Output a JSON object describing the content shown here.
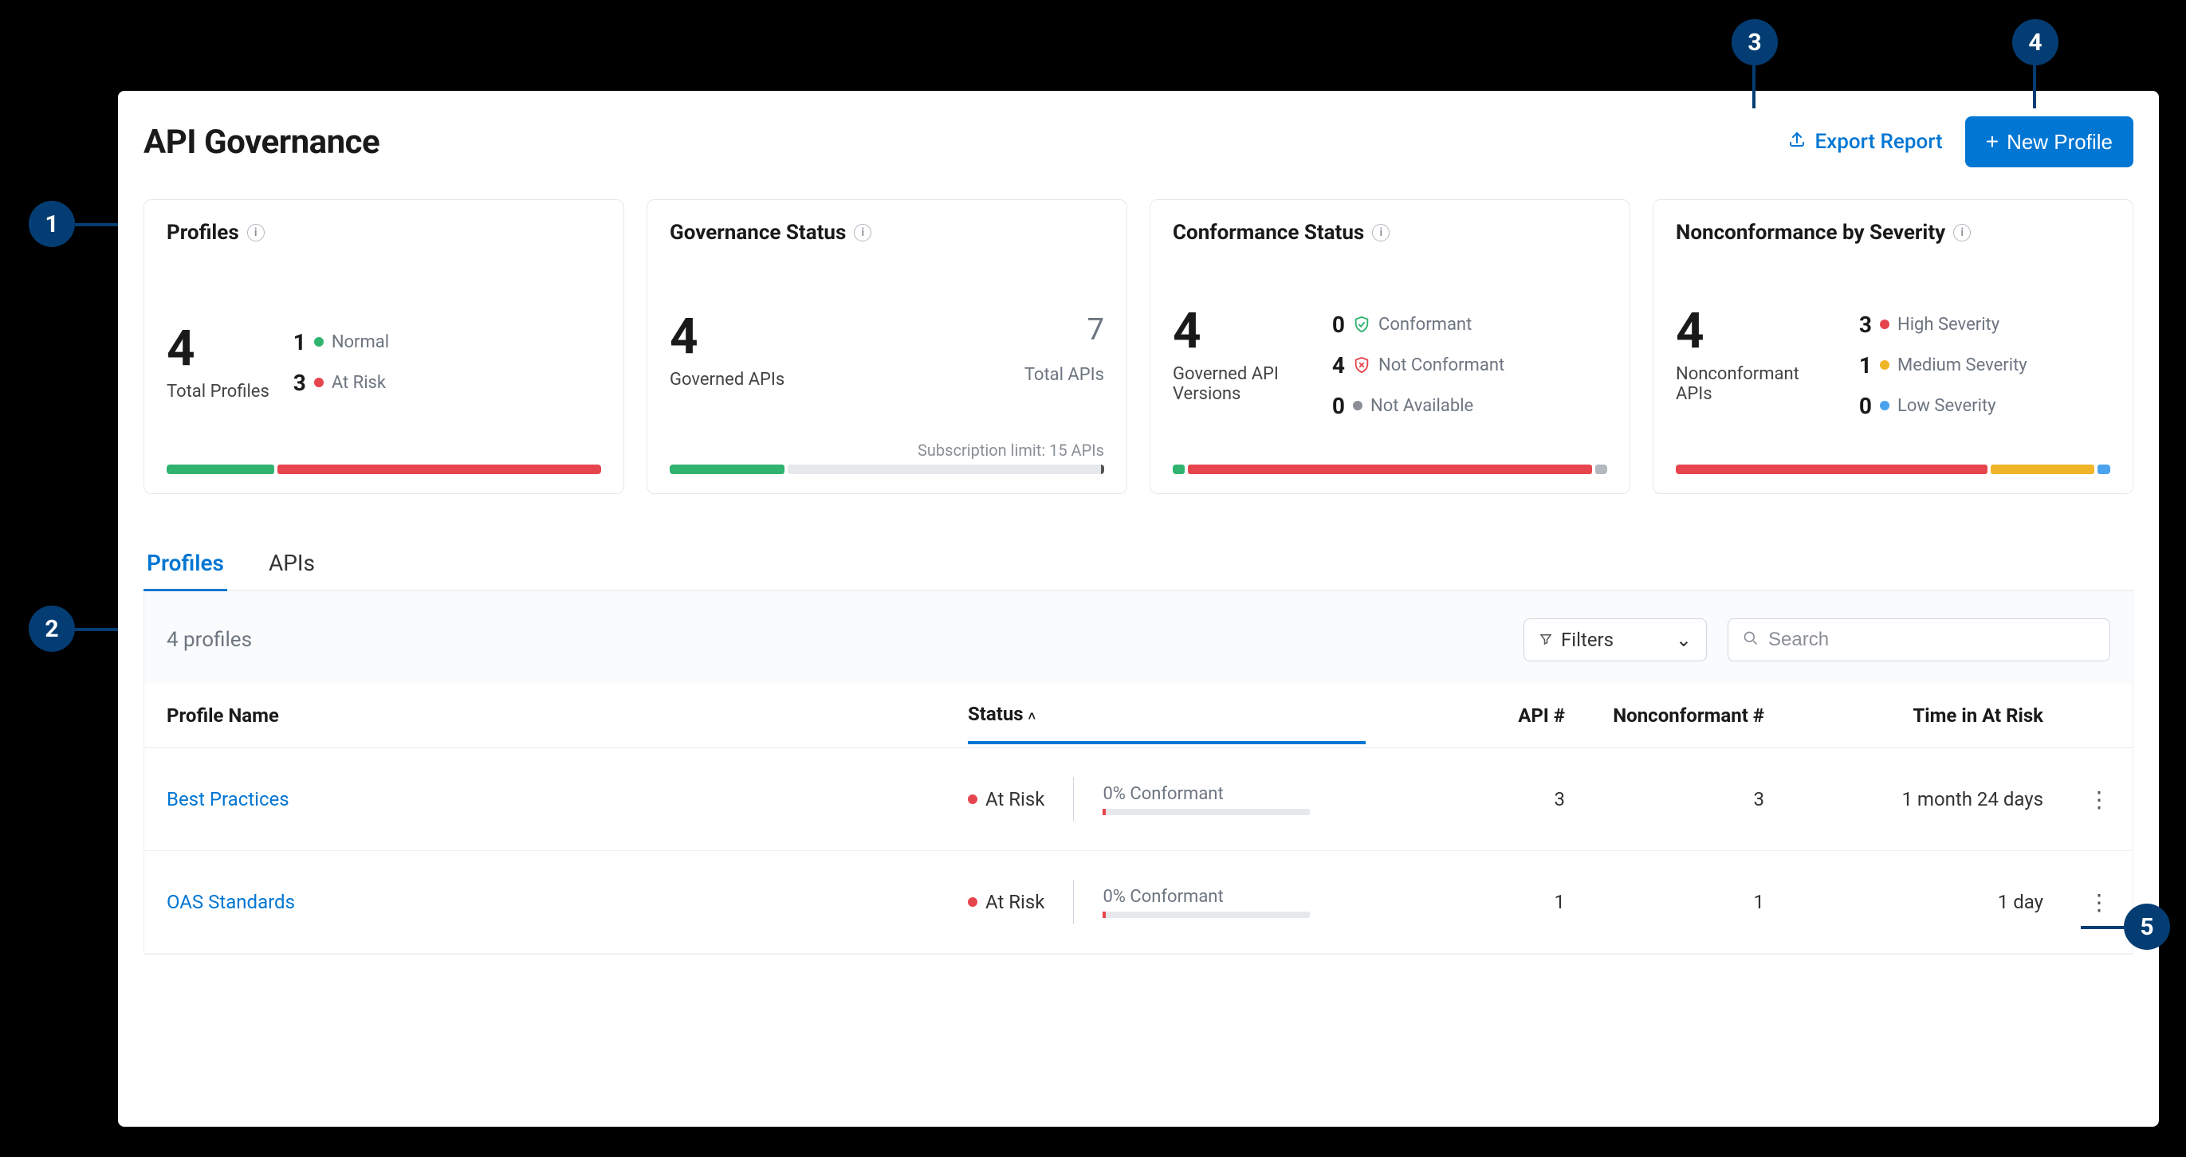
{
  "page": {
    "title": "API Governance",
    "export_label": "Export Report",
    "new_profile_label": "New Profile"
  },
  "callouts": [
    "1",
    "2",
    "3",
    "4",
    "5"
  ],
  "cards": {
    "profiles": {
      "title": "Profiles",
      "value": "4",
      "value_label": "Total Profiles",
      "legend": [
        {
          "count": "1",
          "color": "#2fb36f",
          "label": "Normal"
        },
        {
          "count": "3",
          "color": "#e6454d",
          "label": "At Risk"
        }
      ]
    },
    "governance": {
      "title": "Governance Status",
      "value": "4",
      "value_label": "Governed APIs",
      "total": "7",
      "total_label": "Total APIs",
      "note": "Subscription limit: 15 APIs"
    },
    "conformance": {
      "title": "Conformance Status",
      "value": "4",
      "value_label": "Governed API Versions",
      "legend": [
        {
          "count": "0",
          "color": "#2fb36f",
          "label": "Conformant",
          "icon": "shield-check"
        },
        {
          "count": "4",
          "color": "#e6454d",
          "label": "Not Conformant",
          "icon": "shield-x"
        },
        {
          "count": "0",
          "color": "#8a8f96",
          "label": "Not Available",
          "icon": "dot"
        }
      ]
    },
    "severity": {
      "title": "Nonconformance by Severity",
      "value": "4",
      "value_label": "Nonconformant APIs",
      "legend": [
        {
          "count": "3",
          "color": "#e6454d",
          "label": "High Severity"
        },
        {
          "count": "1",
          "color": "#f0b429",
          "label": "Medium Severity"
        },
        {
          "count": "0",
          "color": "#4aa3ed",
          "label": "Low Severity"
        }
      ]
    }
  },
  "tabs": {
    "profiles": "Profiles",
    "apis": "APIs",
    "active": "profiles"
  },
  "table": {
    "count_label": "4 profiles",
    "filters_label": "Filters",
    "search_placeholder": "Search",
    "cols": {
      "name": "Profile Name",
      "status": "Status",
      "api": "API #",
      "nonconf": "Nonconformant #",
      "time": "Time in At Risk"
    },
    "sort_col": "status",
    "rows": [
      {
        "name": "Best Practices",
        "status": "At Risk",
        "conf_pct": "0% Conformant",
        "api": "3",
        "nc": "3",
        "time": "1 month 24 days"
      },
      {
        "name": "OAS Standards",
        "status": "At Risk",
        "conf_pct": "0% Conformant",
        "api": "1",
        "nc": "1",
        "time": "1 day"
      }
    ]
  },
  "colors": {
    "green": "#2fb36f",
    "red": "#e6454d",
    "yellow": "#f0b429",
    "blue": "#4aa3ed",
    "grey": "#d1d7de",
    "greytext": "#8a8f96"
  }
}
